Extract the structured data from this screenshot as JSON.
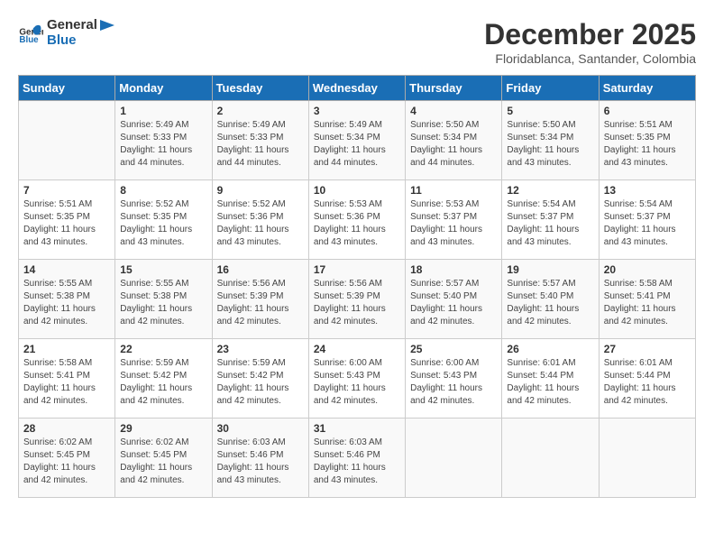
{
  "header": {
    "logo_text_general": "General",
    "logo_text_blue": "Blue",
    "month_year": "December 2025",
    "location": "Floridablanca, Santander, Colombia"
  },
  "weekdays": [
    "Sunday",
    "Monday",
    "Tuesday",
    "Wednesday",
    "Thursday",
    "Friday",
    "Saturday"
  ],
  "weeks": [
    [
      {
        "day": "",
        "info": ""
      },
      {
        "day": "1",
        "info": "Sunrise: 5:49 AM\nSunset: 5:33 PM\nDaylight: 11 hours\nand 44 minutes."
      },
      {
        "day": "2",
        "info": "Sunrise: 5:49 AM\nSunset: 5:33 PM\nDaylight: 11 hours\nand 44 minutes."
      },
      {
        "day": "3",
        "info": "Sunrise: 5:49 AM\nSunset: 5:34 PM\nDaylight: 11 hours\nand 44 minutes."
      },
      {
        "day": "4",
        "info": "Sunrise: 5:50 AM\nSunset: 5:34 PM\nDaylight: 11 hours\nand 44 minutes."
      },
      {
        "day": "5",
        "info": "Sunrise: 5:50 AM\nSunset: 5:34 PM\nDaylight: 11 hours\nand 43 minutes."
      },
      {
        "day": "6",
        "info": "Sunrise: 5:51 AM\nSunset: 5:35 PM\nDaylight: 11 hours\nand 43 minutes."
      }
    ],
    [
      {
        "day": "7",
        "info": "Sunrise: 5:51 AM\nSunset: 5:35 PM\nDaylight: 11 hours\nand 43 minutes."
      },
      {
        "day": "8",
        "info": "Sunrise: 5:52 AM\nSunset: 5:35 PM\nDaylight: 11 hours\nand 43 minutes."
      },
      {
        "day": "9",
        "info": "Sunrise: 5:52 AM\nSunset: 5:36 PM\nDaylight: 11 hours\nand 43 minutes."
      },
      {
        "day": "10",
        "info": "Sunrise: 5:53 AM\nSunset: 5:36 PM\nDaylight: 11 hours\nand 43 minutes."
      },
      {
        "day": "11",
        "info": "Sunrise: 5:53 AM\nSunset: 5:37 PM\nDaylight: 11 hours\nand 43 minutes."
      },
      {
        "day": "12",
        "info": "Sunrise: 5:54 AM\nSunset: 5:37 PM\nDaylight: 11 hours\nand 43 minutes."
      },
      {
        "day": "13",
        "info": "Sunrise: 5:54 AM\nSunset: 5:37 PM\nDaylight: 11 hours\nand 43 minutes."
      }
    ],
    [
      {
        "day": "14",
        "info": "Sunrise: 5:55 AM\nSunset: 5:38 PM\nDaylight: 11 hours\nand 42 minutes."
      },
      {
        "day": "15",
        "info": "Sunrise: 5:55 AM\nSunset: 5:38 PM\nDaylight: 11 hours\nand 42 minutes."
      },
      {
        "day": "16",
        "info": "Sunrise: 5:56 AM\nSunset: 5:39 PM\nDaylight: 11 hours\nand 42 minutes."
      },
      {
        "day": "17",
        "info": "Sunrise: 5:56 AM\nSunset: 5:39 PM\nDaylight: 11 hours\nand 42 minutes."
      },
      {
        "day": "18",
        "info": "Sunrise: 5:57 AM\nSunset: 5:40 PM\nDaylight: 11 hours\nand 42 minutes."
      },
      {
        "day": "19",
        "info": "Sunrise: 5:57 AM\nSunset: 5:40 PM\nDaylight: 11 hours\nand 42 minutes."
      },
      {
        "day": "20",
        "info": "Sunrise: 5:58 AM\nSunset: 5:41 PM\nDaylight: 11 hours\nand 42 minutes."
      }
    ],
    [
      {
        "day": "21",
        "info": "Sunrise: 5:58 AM\nSunset: 5:41 PM\nDaylight: 11 hours\nand 42 minutes."
      },
      {
        "day": "22",
        "info": "Sunrise: 5:59 AM\nSunset: 5:42 PM\nDaylight: 11 hours\nand 42 minutes."
      },
      {
        "day": "23",
        "info": "Sunrise: 5:59 AM\nSunset: 5:42 PM\nDaylight: 11 hours\nand 42 minutes."
      },
      {
        "day": "24",
        "info": "Sunrise: 6:00 AM\nSunset: 5:43 PM\nDaylight: 11 hours\nand 42 minutes."
      },
      {
        "day": "25",
        "info": "Sunrise: 6:00 AM\nSunset: 5:43 PM\nDaylight: 11 hours\nand 42 minutes."
      },
      {
        "day": "26",
        "info": "Sunrise: 6:01 AM\nSunset: 5:44 PM\nDaylight: 11 hours\nand 42 minutes."
      },
      {
        "day": "27",
        "info": "Sunrise: 6:01 AM\nSunset: 5:44 PM\nDaylight: 11 hours\nand 42 minutes."
      }
    ],
    [
      {
        "day": "28",
        "info": "Sunrise: 6:02 AM\nSunset: 5:45 PM\nDaylight: 11 hours\nand 42 minutes."
      },
      {
        "day": "29",
        "info": "Sunrise: 6:02 AM\nSunset: 5:45 PM\nDaylight: 11 hours\nand 42 minutes."
      },
      {
        "day": "30",
        "info": "Sunrise: 6:03 AM\nSunset: 5:46 PM\nDaylight: 11 hours\nand 43 minutes."
      },
      {
        "day": "31",
        "info": "Sunrise: 6:03 AM\nSunset: 5:46 PM\nDaylight: 11 hours\nand 43 minutes."
      },
      {
        "day": "",
        "info": ""
      },
      {
        "day": "",
        "info": ""
      },
      {
        "day": "",
        "info": ""
      }
    ]
  ]
}
